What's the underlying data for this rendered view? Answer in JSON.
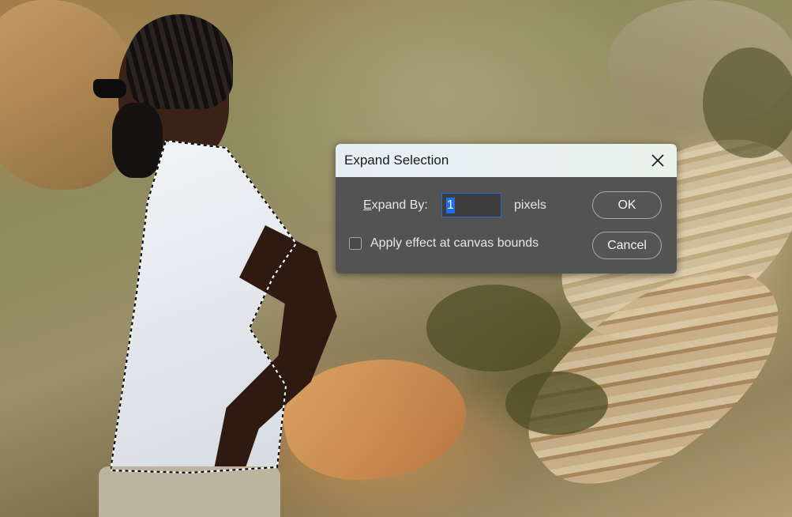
{
  "dialog": {
    "title": "Expand Selection",
    "close_icon": "close-icon",
    "expand_label_accel": "E",
    "expand_label_rest": "xpand By:",
    "expand_value": "1",
    "unit": "pixels",
    "checkbox_label": "Apply effect at canvas bounds",
    "checkbox_checked": false,
    "ok_label": "OK",
    "cancel_label": "Cancel"
  },
  "canvas": {
    "image": "photo-man-white-tshirt-rocky-hillside",
    "selection": "marching-ants-selection-around-tshirt"
  },
  "colors": {
    "dialog_bg": "#535353",
    "titlebar_bg": "#e8f1ef",
    "input_focus": "#2f68d6",
    "text_highlight": "#1f6fe8"
  }
}
